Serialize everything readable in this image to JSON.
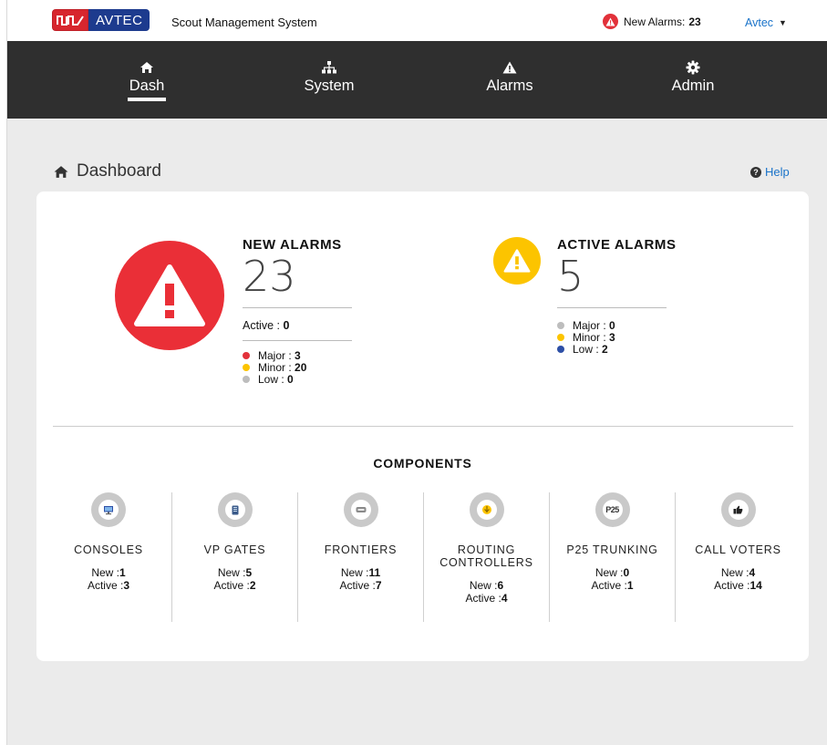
{
  "header": {
    "logo_text": "AVTEC",
    "app_title": "Scout Management System",
    "new_alarms_label": "New Alarms:",
    "new_alarms_count": "23",
    "user_menu": "Avtec"
  },
  "nav": {
    "items": [
      {
        "label": "Dash",
        "icon": "home-icon",
        "active": true
      },
      {
        "label": "System",
        "icon": "sitemap-icon",
        "active": false
      },
      {
        "label": "Alarms",
        "icon": "warning-icon",
        "active": false
      },
      {
        "label": "Admin",
        "icon": "gear-icon",
        "active": false
      }
    ]
  },
  "page": {
    "title": "Dashboard",
    "help": "Help"
  },
  "new_alarms": {
    "title": "NEW ALARMS",
    "count": "23",
    "active_label": "Active :",
    "active_value": "0",
    "legend": [
      {
        "label": "Major :",
        "value": "3",
        "color": "#e2313a"
      },
      {
        "label": "Minor :",
        "value": "20",
        "color": "#fcc400"
      },
      {
        "label": "Low :",
        "value": "0",
        "color": "#bdbdbd"
      }
    ]
  },
  "active_alarms": {
    "title": "ACTIVE ALARMS",
    "count": "5",
    "legend": [
      {
        "label": "Major :",
        "value": "0",
        "color": "#bdbdbd"
      },
      {
        "label": "Minor :",
        "value": "3",
        "color": "#fcc400"
      },
      {
        "label": "Low :",
        "value": "2",
        "color": "#2d4fa6"
      }
    ]
  },
  "components": {
    "title": "COMPONENTS",
    "new_label": "New :",
    "active_label": "Active :",
    "items": [
      {
        "name": "CONSOLES",
        "new": "1",
        "active": "3",
        "icon": "console-icon"
      },
      {
        "name": "VP GATES",
        "new": "5",
        "active": "2",
        "icon": "gateway-icon"
      },
      {
        "name": "FRONTIERS",
        "new": "11",
        "active": "7",
        "icon": "router-icon"
      },
      {
        "name_line1": "ROUTING",
        "name_line2": "CONTROLLERS",
        "new": "6",
        "active": "4",
        "icon": "controller-icon"
      },
      {
        "name": "P25 TRUNKING",
        "new": "0",
        "active": "1",
        "icon": "p25-icon",
        "icon_text": "P25"
      },
      {
        "name": "CALL VOTERS",
        "new": "4",
        "active": "14",
        "icon": "thumbs-up-icon"
      }
    ]
  },
  "colors": {
    "nav_bg": "#2f2f2f",
    "alarm_red": "#ea2f37",
    "alarm_yellow": "#fcc400",
    "link_blue": "#1a73c9",
    "low_blue": "#2d4fa6"
  }
}
